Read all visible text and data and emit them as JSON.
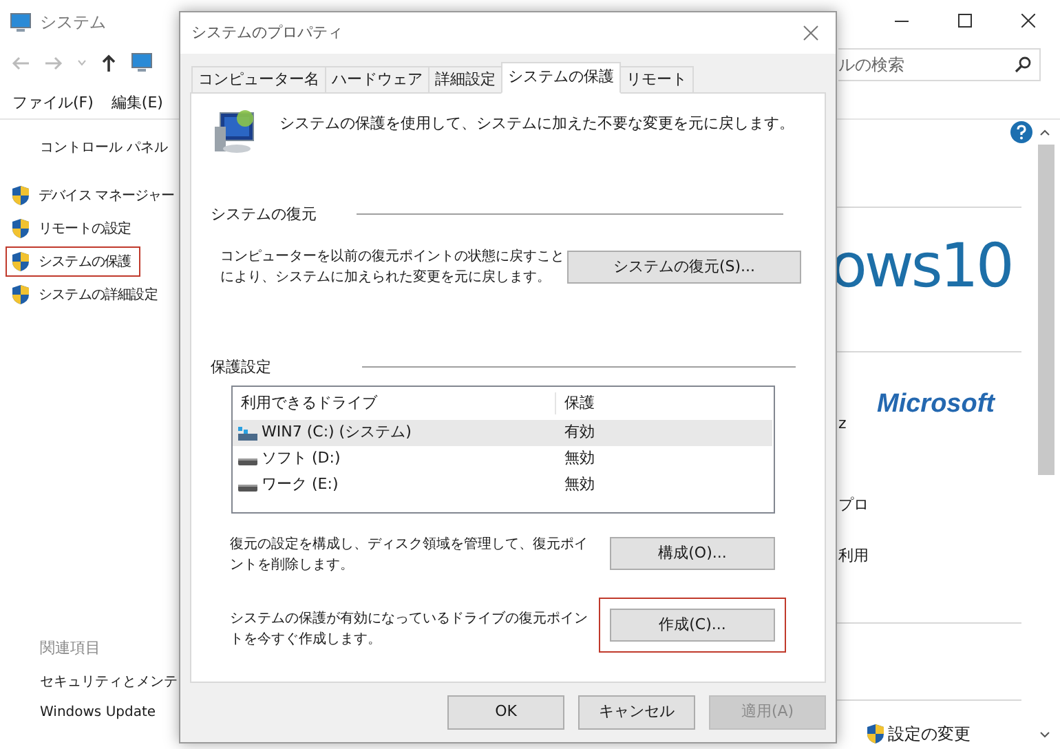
{
  "window": {
    "title": "システム",
    "search": {
      "placeholder": "ルの検索"
    },
    "menu": [
      "ファイル(F)",
      "編集(E)"
    ],
    "sidebar": {
      "home": "コントロール パネル",
      "items": [
        {
          "label": "デバイス マネージャー",
          "highlighted": false
        },
        {
          "label": "リモートの設定",
          "highlighted": false
        },
        {
          "label": "システムの保護",
          "highlighted": true
        },
        {
          "label": "システムの詳細設定",
          "highlighted": false
        }
      ],
      "related_heading": "関連項目",
      "related": [
        "セキュリティとメンテ",
        "Windows Update"
      ]
    },
    "content": {
      "logo_text": "ows10",
      "brand": "Microsoft",
      "fragments": [
        "z",
        "プロ",
        "利用"
      ],
      "change_settings": "設定の変更"
    }
  },
  "dialog": {
    "title": "システムのプロパティ",
    "tabs": [
      {
        "label": "コンピューター名",
        "selected": false
      },
      {
        "label": "ハードウェア",
        "selected": false
      },
      {
        "label": "詳細設定",
        "selected": false
      },
      {
        "label": "システムの保護",
        "selected": true
      },
      {
        "label": "リモート",
        "selected": false
      }
    ],
    "intro": "システムの保護を使用して、システムに加えた不要な変更を元に戻します。",
    "restore": {
      "heading": "システムの復元",
      "text": "コンピューターを以前の復元ポイントの状態に戻すことにより、システムに加えられた変更を元に戻します。",
      "button": "システムの復元(S)..."
    },
    "protection": {
      "heading": "保護設定",
      "columns": [
        "利用できるドライブ",
        "保護"
      ],
      "drives": [
        {
          "kind": "system",
          "name": "WIN7 (C:) (システム)",
          "status": "有効",
          "selected": true
        },
        {
          "kind": "disk",
          "name": "ソフト (D:)",
          "status": "無効",
          "selected": false
        },
        {
          "kind": "disk",
          "name": "ワーク (E:)",
          "status": "無効",
          "selected": false
        }
      ],
      "actions": [
        {
          "text": "復元の設定を構成し、ディスク領域を管理して、復元ポイントを削除します。",
          "button": "構成(O)...",
          "highlighted": false
        },
        {
          "text": "システムの保護が有効になっているドライブの復元ポイントを今すぐ作成します。",
          "button": "作成(C)...",
          "highlighted": true
        }
      ]
    },
    "buttons": [
      {
        "label": "OK",
        "disabled": false
      },
      {
        "label": "キャンセル",
        "disabled": false
      },
      {
        "label": "適用(A)",
        "disabled": true
      }
    ]
  }
}
